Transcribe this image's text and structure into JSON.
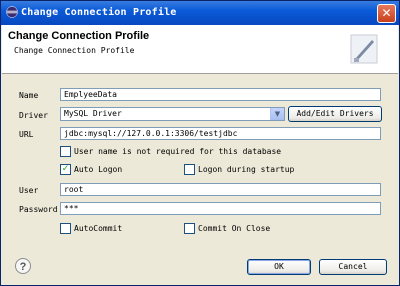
{
  "window": {
    "title": "Change Connection Profile",
    "close_glyph": "✕",
    "app_icon": "eclipse-icon"
  },
  "banner": {
    "heading": "Change Connection Profile",
    "subheading": "Change Connection Profile",
    "logo_icon": "connection-profile-logo-icon"
  },
  "form": {
    "name_label": "Name",
    "name_value": "EmplyeeData",
    "driver_label": "Driver",
    "driver_value": "MySQL Driver",
    "add_edit_drivers_label": "Add/Edit Drivers",
    "url_label": "URL",
    "url_value": "jdbc:mysql://127.0.0.1:3306/testjdbc",
    "user_not_required_label": "User name is not required for this database",
    "user_not_required_checked": false,
    "auto_logon_label": "Auto Logon",
    "auto_logon_checked": true,
    "logon_startup_label": "Logon during startup",
    "logon_startup_checked": false,
    "user_label": "User",
    "user_value": "root",
    "password_label": "Password",
    "password_value": "***",
    "autocommit_label": "AutoCommit",
    "autocommit_checked": false,
    "commit_on_close_label": "Commit On Close",
    "commit_on_close_checked": false
  },
  "footer": {
    "help_glyph": "?",
    "ok_label": "OK",
    "cancel_label": "Cancel"
  },
  "colors": {
    "titlebar": "#0a5ad8",
    "dialog_bg": "#ece9d8",
    "field_border": "#7f9db9"
  }
}
